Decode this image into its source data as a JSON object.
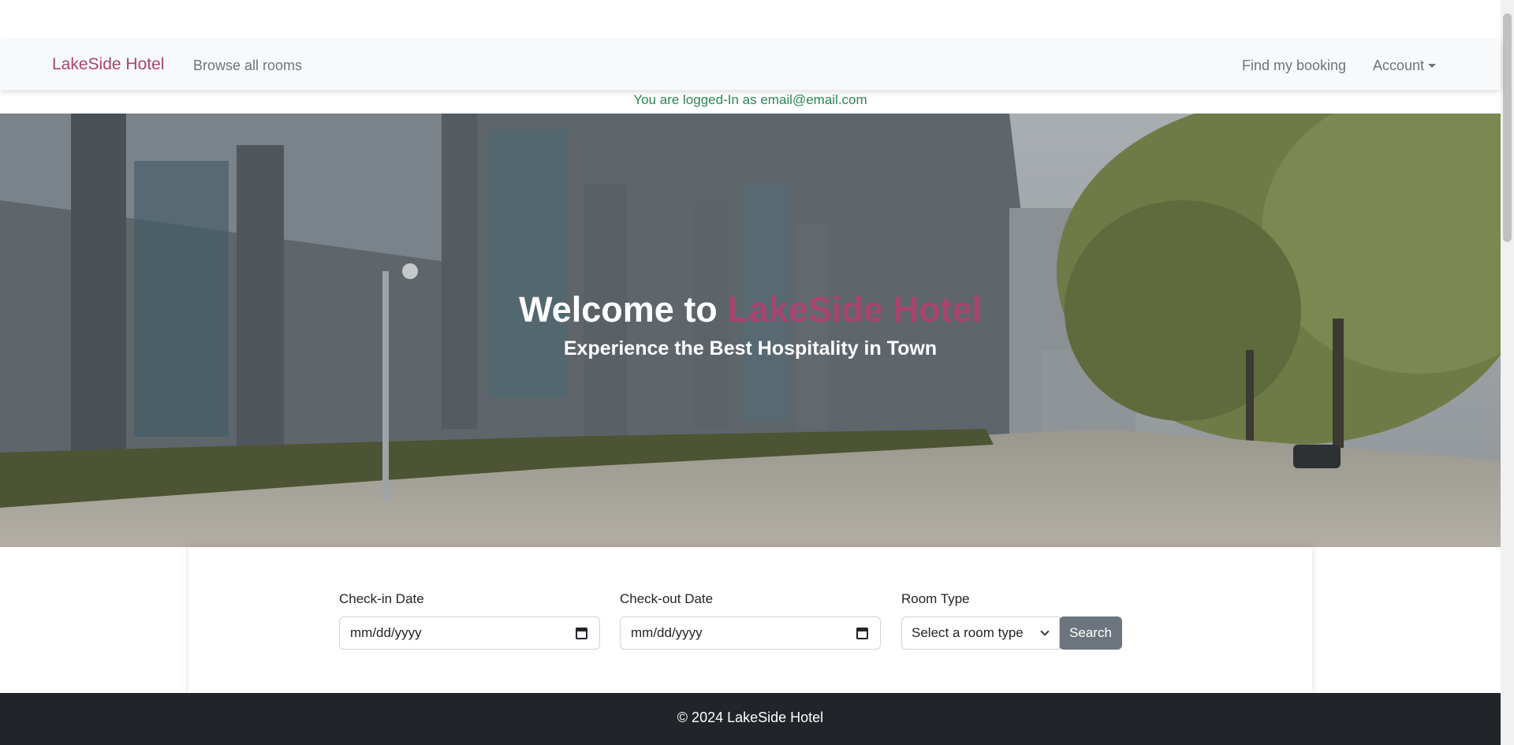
{
  "navbar": {
    "brand": "LakeSide Hotel",
    "browse": "Browse all rooms",
    "find_booking": "Find my booking",
    "account": "Account"
  },
  "login_message": "You are logged-In as email@email.com",
  "hero": {
    "title_prefix": "Welcome to",
    "title_highlight": "LakeSide Hotel",
    "subtitle": "Experience the Best Hospitality in Town"
  },
  "search": {
    "checkin_label": "Check-in Date",
    "checkin_placeholder": "mm/dd/yyyy",
    "checkout_label": "Check-out Date",
    "checkout_placeholder": "mm/dd/yyyy",
    "roomtype_label": "Room Type",
    "roomtype_placeholder": "Select a room type",
    "button": "Search"
  },
  "footer": {
    "copyright": "© 2024 LakeSide Hotel"
  },
  "colors": {
    "brand": "#a7456f",
    "logged_in": "#2a8654",
    "footer_bg": "#212529",
    "button_bg": "#6c757d"
  }
}
